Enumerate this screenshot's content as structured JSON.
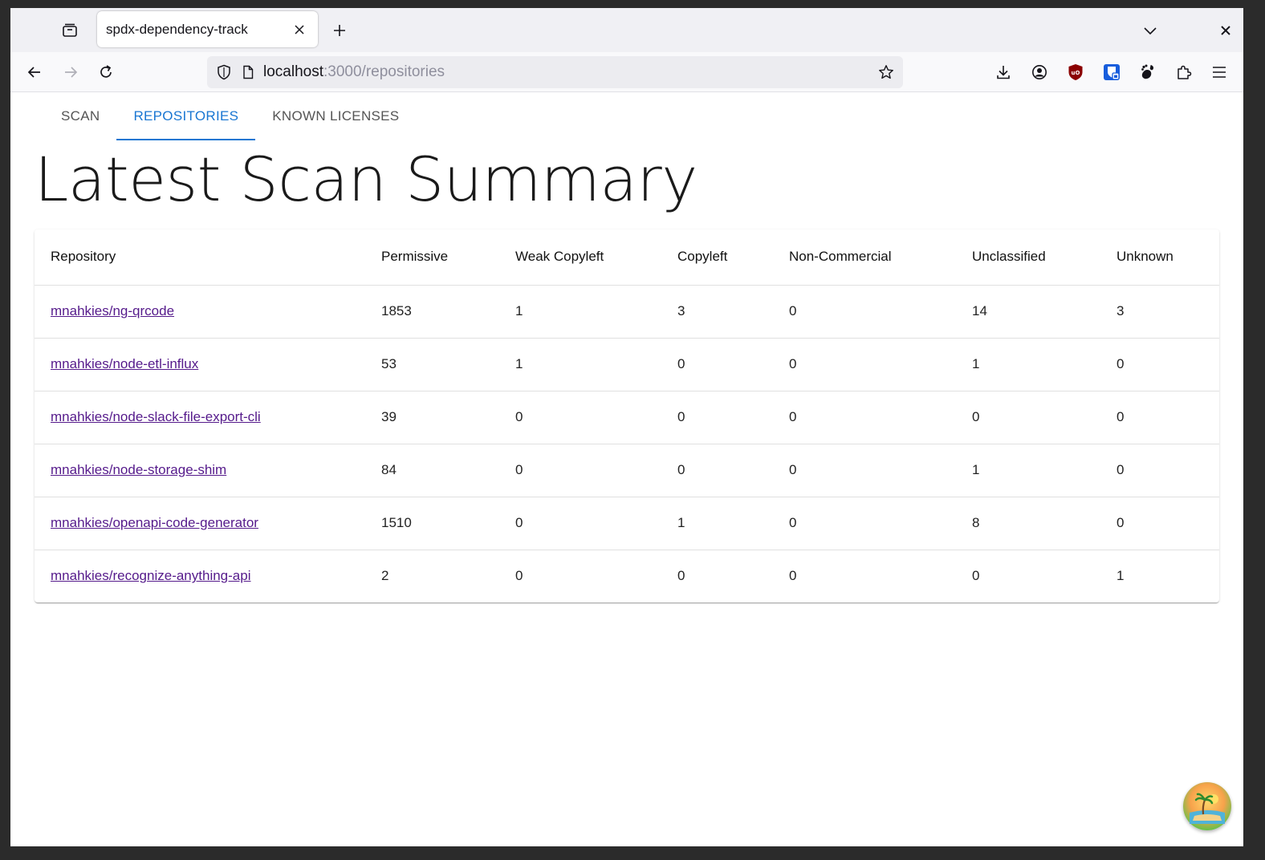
{
  "browser": {
    "tab_title": "spdx-dependency-track",
    "url_host": "localhost",
    "url_path": ":3000/repositories"
  },
  "app": {
    "tabs": [
      {
        "label": "SCAN",
        "active": false
      },
      {
        "label": "REPOSITORIES",
        "active": true
      },
      {
        "label": "KNOWN LICENSES",
        "active": false
      }
    ],
    "title": "Latest Scan Summary"
  },
  "table": {
    "columns": [
      "Repository",
      "Permissive",
      "Weak Copyleft",
      "Copyleft",
      "Non-Commercial",
      "Unclassified",
      "Unknown"
    ],
    "rows": [
      {
        "repo": "mnahkies/ng-qrcode",
        "permissive": "1853",
        "weak_copyleft": "1",
        "copyleft": "3",
        "non_commercial": "0",
        "unclassified": "14",
        "unknown": "3"
      },
      {
        "repo": "mnahkies/node-etl-influx",
        "permissive": "53",
        "weak_copyleft": "1",
        "copyleft": "0",
        "non_commercial": "0",
        "unclassified": "1",
        "unknown": "0"
      },
      {
        "repo": "mnahkies/node-slack-file-export-cli",
        "permissive": "39",
        "weak_copyleft": "0",
        "copyleft": "0",
        "non_commercial": "0",
        "unclassified": "0",
        "unknown": "0"
      },
      {
        "repo": "mnahkies/node-storage-shim",
        "permissive": "84",
        "weak_copyleft": "0",
        "copyleft": "0",
        "non_commercial": "0",
        "unclassified": "1",
        "unknown": "0"
      },
      {
        "repo": "mnahkies/openapi-code-generator",
        "permissive": "1510",
        "weak_copyleft": "0",
        "copyleft": "1",
        "non_commercial": "0",
        "unclassified": "8",
        "unknown": "0"
      },
      {
        "repo": "mnahkies/recognize-anything-api",
        "permissive": "2",
        "weak_copyleft": "0",
        "copyleft": "0",
        "non_commercial": "0",
        "unclassified": "0",
        "unknown": "1"
      }
    ]
  },
  "colors": {
    "accent": "#1976d2",
    "link": "#551a8b"
  },
  "icons": [
    "tab-overview-icon",
    "close-icon",
    "plus-icon",
    "chevron-down-icon",
    "back-icon",
    "forward-icon",
    "reload-icon",
    "shield-icon",
    "page-icon",
    "star-icon",
    "download-icon",
    "account-icon",
    "ublock-icon",
    "bitwarden-icon",
    "gnome-icon",
    "extensions-icon",
    "menu-icon",
    "assistant-fab-icon"
  ]
}
